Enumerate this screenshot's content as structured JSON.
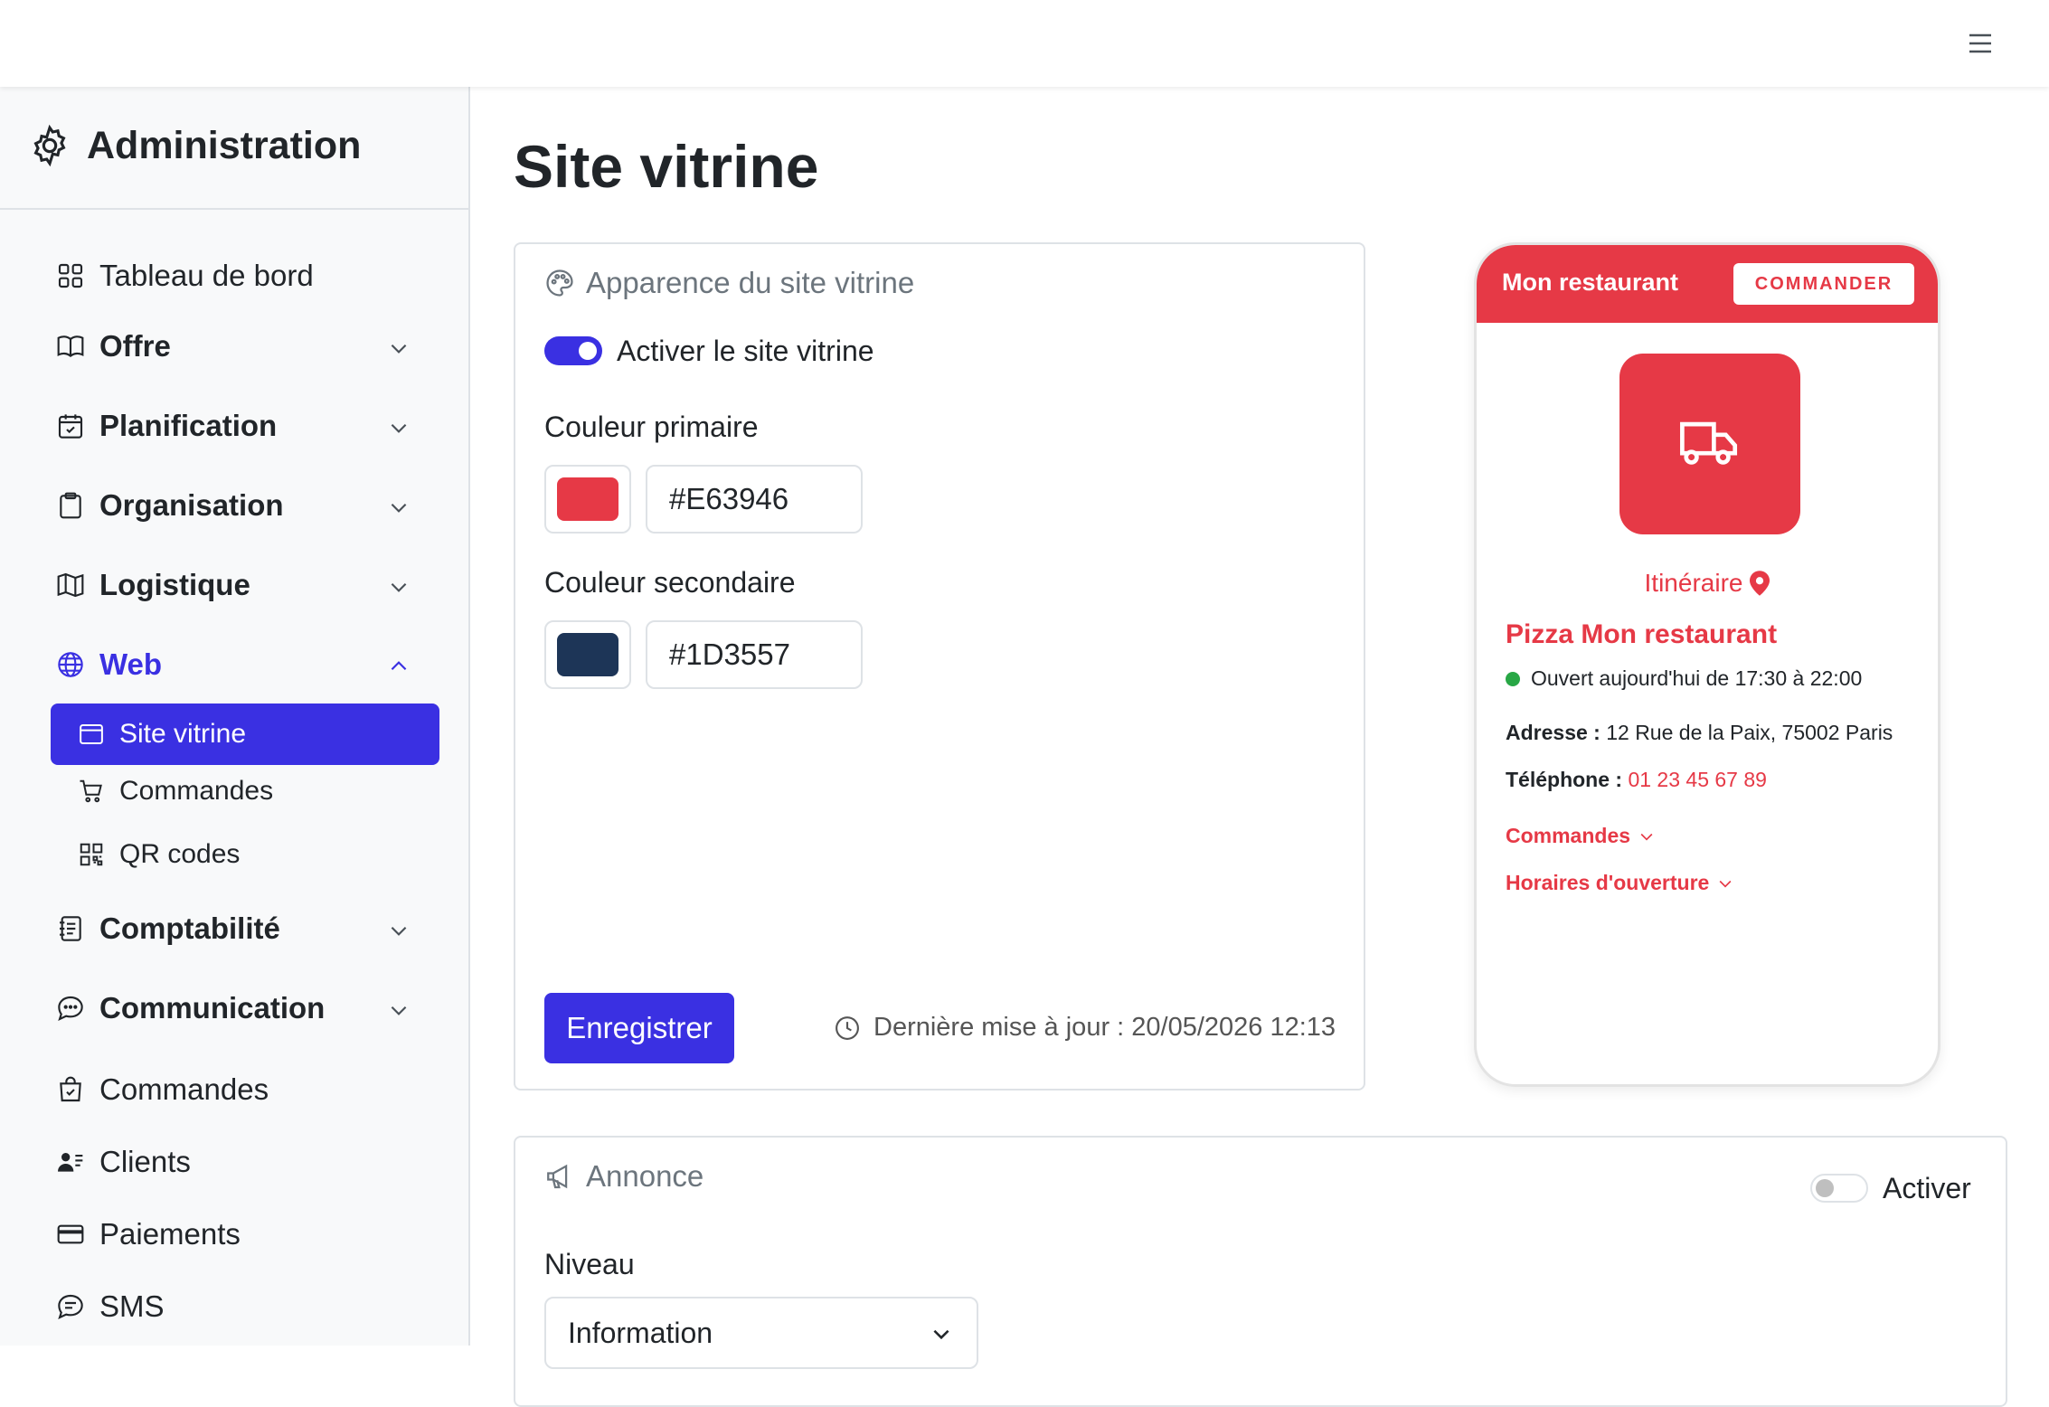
{
  "sidebar": {
    "brand": "Administration",
    "items": [
      {
        "label": "Tableau de bord"
      },
      {
        "label": "Offre"
      },
      {
        "label": "Planification"
      },
      {
        "label": "Organisation"
      },
      {
        "label": "Logistique"
      },
      {
        "label": "Web"
      },
      {
        "label": "Comptabilité"
      },
      {
        "label": "Communication"
      },
      {
        "label": "Commandes"
      },
      {
        "label": "Clients"
      },
      {
        "label": "Paiements"
      },
      {
        "label": "SMS"
      }
    ],
    "web_subitems": [
      {
        "label": "Site vitrine"
      },
      {
        "label": "Commandes"
      },
      {
        "label": "QR codes"
      }
    ]
  },
  "main": {
    "title": "Site vitrine",
    "appearance": {
      "title": "Apparence du site vitrine",
      "enable_label": "Activer le site vitrine",
      "enabled": true,
      "primary_label": "Couleur primaire",
      "primary_value": "#E63946",
      "secondary_label": "Couleur secondaire",
      "secondary_value": "#1D3557",
      "save_label": "Enregistrer",
      "last_update": "Dernière mise à jour : 20/05/2026 12:13"
    },
    "preview": {
      "restaurant_short": "Mon restaurant",
      "order_button": "COMMANDER",
      "itinerary": "Itinéraire",
      "restaurant_name": "Pizza Mon restaurant",
      "opening_status": "Ouvert aujourd'hui de 17:30 à 22:00",
      "address_label": "Adresse :",
      "address_value": "12 Rue de la Paix, 75002 Paris",
      "phone_label": "Téléphone :",
      "phone_value": "01 23 45 67 89",
      "orders_link": "Commandes",
      "hours_link": "Horaires d'ouverture"
    },
    "announcement": {
      "title": "Annonce",
      "toggle_label": "Activer",
      "enabled": false,
      "level_label": "Niveau",
      "level_value": "Information"
    }
  },
  "colors": {
    "accent": "#3A30E2",
    "primary": "#E63946",
    "secondary": "#1D3557",
    "status_open": "#28A745"
  }
}
